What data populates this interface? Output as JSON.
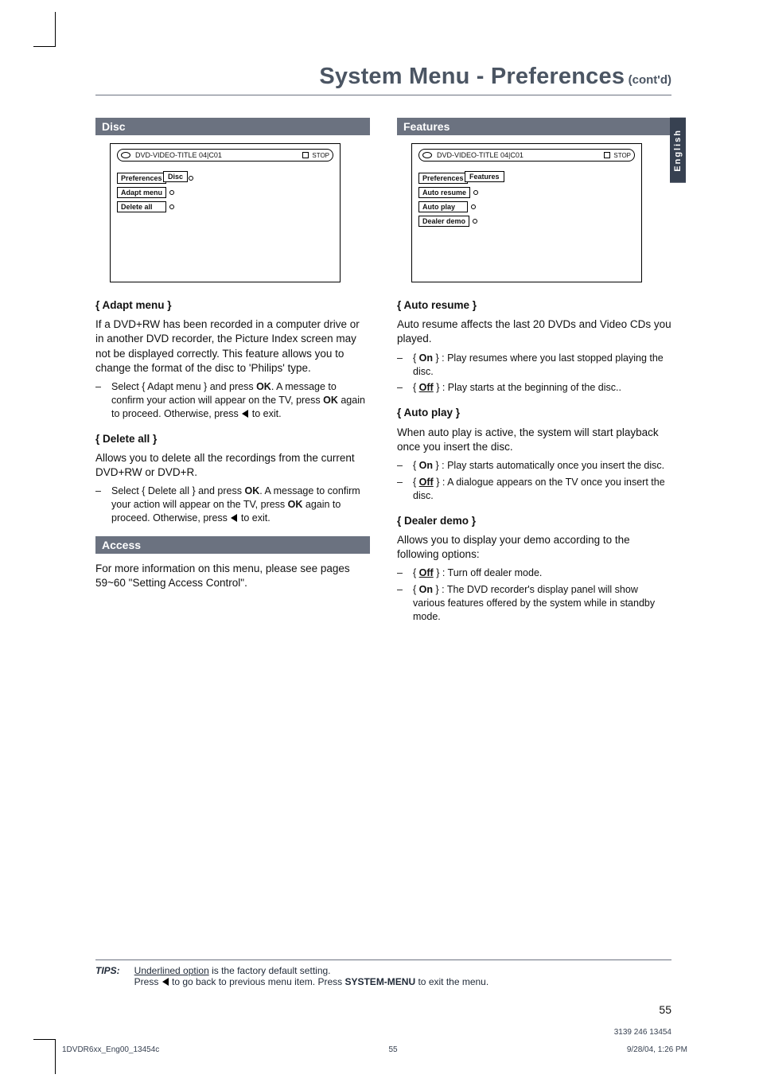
{
  "title": {
    "main": "System Menu - Preferences",
    "contd": "(cont'd)"
  },
  "side_tab": "English",
  "disc": {
    "bar": "Disc",
    "menu_title_prefix": "DVD-VIDEO-TITLE 04|C01",
    "stop_label": "STOP",
    "tree": {
      "crumb": "Disc",
      "preferences": "Preferences",
      "rows": [
        "Adapt menu",
        "Delete all"
      ]
    },
    "adapt_menu": {
      "heading": "{ Adapt menu }",
      "para": "If a DVD+RW has been recorded in a computer drive or in another DVD recorder, the Picture Index screen may not be displayed correctly.  This feature allows you to change the format of the disc to 'Philips' type.",
      "bullet_a": "Select { Adapt menu } and press ",
      "bullet_b": ". A message to confirm your action will appear on the TV, press ",
      "bullet_c": " again to proceed. Otherwise, press ",
      "bullet_d": " to exit.",
      "ok": "OK"
    },
    "delete_all": {
      "heading": "{ Delete all }",
      "para": "Allows you to delete all the recordings from the current DVD+RW or DVD+R.",
      "bullet_a": "Select { Delete all } and press ",
      "bullet_b": ". A message to confirm your action will appear on the TV, press ",
      "bullet_c": " again to proceed. Otherwise, press ",
      "bullet_d": " to exit.",
      "ok": "OK"
    }
  },
  "access": {
    "bar": "Access",
    "para": "For more information on this menu, please see pages 59~60 \"Setting Access Control\"."
  },
  "features": {
    "bar": "Features",
    "menu_title_prefix": "DVD-VIDEO-TITLE 04|C01",
    "stop_label": "STOP",
    "tree": {
      "crumb": "Features",
      "preferences": "Preferences",
      "rows": [
        "Auto resume",
        "Auto play",
        "Dealer demo"
      ]
    },
    "auto_resume": {
      "heading": "{ Auto resume }",
      "para": "Auto resume affects the last 20 DVDs and Video CDs you played.",
      "on_label": "On",
      "on_text": " } : Play resumes where you last stopped playing the disc.",
      "off_label": "Off",
      "off_text": " } : Play starts at the beginning of the disc.."
    },
    "auto_play": {
      "heading": "{ Auto play }",
      "para": "When auto play is active, the system will start playback once you insert the disc.",
      "on_label": "On",
      "on_text": " } : Play starts automatically once you insert the disc.",
      "off_label": "Off",
      "off_text": " } : A dialogue appears on the TV once you insert the disc."
    },
    "dealer_demo": {
      "heading": "{ Dealer demo }",
      "para": "Allows you to display your demo according to the following options:",
      "off_label": "Off",
      "off_text": " } : Turn off dealer mode.",
      "on_label": "On",
      "on_text": " } : The DVD recorder's display panel will show various features offered by the system while in standby mode."
    }
  },
  "tips": {
    "label": "TIPS:",
    "line1_a": "Underlined option",
    "line1_b": " is the factory default setting.",
    "line2_a": "Press ",
    "line2_b": " to go back to previous menu item.  Press ",
    "line2_c": "SYSTEM-MENU",
    "line2_d": " to exit the menu."
  },
  "page_number": "55",
  "part_number": "3139 246 13454",
  "footer": {
    "file": "1DVDR6xx_Eng00_13454c",
    "page": "55",
    "timestamp": "9/28/04, 1:26 PM"
  }
}
